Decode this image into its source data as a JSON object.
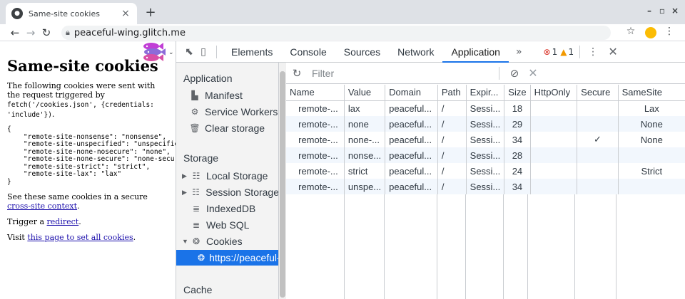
{
  "browser": {
    "tab_title": "Same-site cookies",
    "url": "peaceful-wing.glitch.me"
  },
  "page": {
    "title": "Same-site cookies",
    "intro_text": "The following cookies were sent with the request triggered by ",
    "intro_code": "fetch('/cookies.json', {credentials: 'include'})",
    "intro_end": ".",
    "json_output": "{\n    \"remote-site-nonsense\": \"nonsense\",\n    \"remote-site-unspecified\": \"unspecified\",\n    \"remote-site-none-nosecure\": \"none\",\n    \"remote-site-none-secure\": \"none-secure\",\n    \"remote-site-strict\": \"strict\",\n    \"remote-site-lax\": \"lax\"\n}",
    "secure_text": "See these same cookies in a secure ",
    "secure_link": "cross-site context",
    "secure_end": ".",
    "redirect_text": "Trigger a ",
    "redirect_link": "redirect",
    "redirect_end": ".",
    "visit_text": "Visit ",
    "visit_link": "this page to set all cookies",
    "visit_end": "."
  },
  "devtools": {
    "tabs": [
      "Elements",
      "Console",
      "Sources",
      "Network",
      "Application"
    ],
    "active_tab": "Application",
    "more": "»",
    "error_count": "1",
    "warning_count": "1",
    "sidebar": {
      "application_heading": "Application",
      "manifest": "Manifest",
      "service_workers": "Service Workers",
      "clear_storage": "Clear storage",
      "storage_heading": "Storage",
      "local_storage": "Local Storage",
      "session_storage": "Session Storage",
      "indexeddb": "IndexedDB",
      "web_sql": "Web SQL",
      "cookies": "Cookies",
      "cookie_origin": "https://peaceful-wing.glitch.me",
      "cache_heading": "Cache"
    },
    "filter_placeholder": "Filter",
    "columns": [
      "Name",
      "Value",
      "Domain",
      "Path",
      "Expir...",
      "Size",
      "HttpOnly",
      "Secure",
      "SameSite"
    ],
    "rows": [
      {
        "name": "remote-...",
        "value": "lax",
        "domain": "peaceful...",
        "path": "/",
        "expires": "Sessi...",
        "size": "18",
        "httponly": "",
        "secure": "",
        "samesite": "Lax"
      },
      {
        "name": "remote-...",
        "value": "none",
        "domain": "peaceful...",
        "path": "/",
        "expires": "Sessi...",
        "size": "29",
        "httponly": "",
        "secure": "",
        "samesite": "None"
      },
      {
        "name": "remote-...",
        "value": "none-...",
        "domain": "peaceful...",
        "path": "/",
        "expires": "Sessi...",
        "size": "34",
        "httponly": "",
        "secure": "✓",
        "samesite": "None"
      },
      {
        "name": "remote-...",
        "value": "nonse...",
        "domain": "peaceful...",
        "path": "/",
        "expires": "Sessi...",
        "size": "28",
        "httponly": "",
        "secure": "",
        "samesite": ""
      },
      {
        "name": "remote-...",
        "value": "strict",
        "domain": "peaceful...",
        "path": "/",
        "expires": "Sessi...",
        "size": "24",
        "httponly": "",
        "secure": "",
        "samesite": "Strict"
      },
      {
        "name": "remote-...",
        "value": "unspe...",
        "domain": "peaceful...",
        "path": "/",
        "expires": "Sessi...",
        "size": "34",
        "httponly": "",
        "secure": "",
        "samesite": ""
      }
    ]
  }
}
